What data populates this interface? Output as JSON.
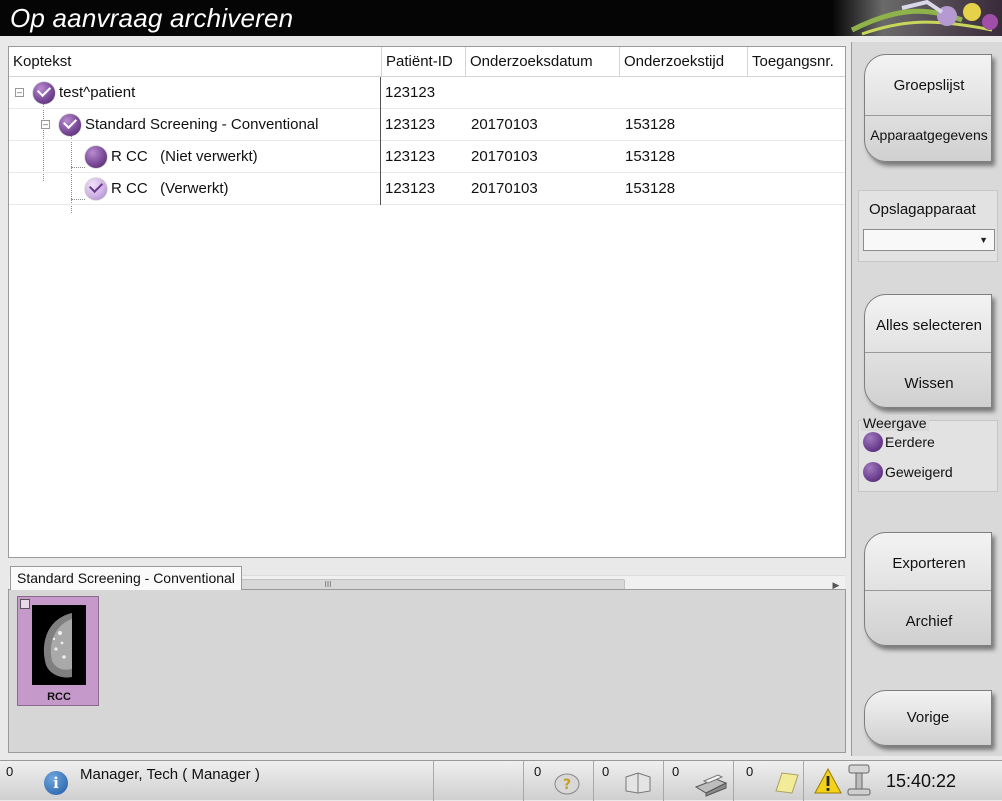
{
  "window": {
    "title": "Op aanvraag archiveren"
  },
  "table": {
    "headers": [
      "Koptekst",
      "Patiënt-ID",
      "Onderzoeksdatum",
      "Onderzoekstijd",
      "Toegangsnr."
    ],
    "rows": [
      {
        "label": "test^patient",
        "patient_id": "123123",
        "date": "",
        "time": "",
        "status_icon": "checked-purple-orb"
      },
      {
        "label": "Standard Screening - Conventional",
        "patient_id": "123123",
        "date": "20170103",
        "time": "153128",
        "status_icon": "checked-purple-orb"
      },
      {
        "label": "R CC   (Niet verwerkt)",
        "patient_id": "123123",
        "date": "20170103",
        "time": "153128",
        "status_icon": "purple-orb"
      },
      {
        "label": "R CC   (Verwerkt)",
        "patient_id": "123123",
        "date": "20170103",
        "time": "153128",
        "status_icon": "checked-light-orb"
      }
    ]
  },
  "scrollbar": {
    "thumb_grip": "III",
    "left_arrow": "◀",
    "right_arrow": "▶"
  },
  "tabs": [
    {
      "label": "Standard Screening - Conventional"
    }
  ],
  "thumbnail": {
    "label": "RCC"
  },
  "side": {
    "group_list": "Groepslijst",
    "device_data": "Apparaatgegevens",
    "storage_label": "Opslagapparaat",
    "storage_value": "",
    "select_all": "Alles selecteren",
    "clear": "Wissen",
    "view_label": "Weergave",
    "legend": [
      "Eerdere",
      "Geweigerd"
    ],
    "export": "Exporteren",
    "archive": "Archief",
    "previous": "Vorige"
  },
  "status": {
    "count_left": "0",
    "user": "Manager, Tech ( Manager )",
    "counts": [
      "0",
      "0",
      "0",
      "0"
    ],
    "time": "15:40:22"
  },
  "colors": {
    "title_bg": "#050505",
    "accent_purple": "#6c3f8e",
    "thumb_bg": "#c59acb"
  }
}
